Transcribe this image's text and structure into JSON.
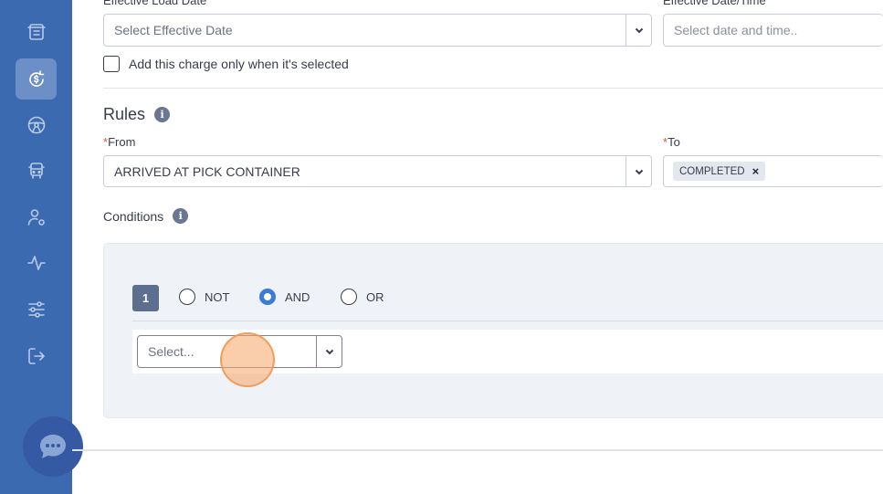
{
  "sidebar": {
    "items": [
      {
        "icon": "receipt-icon",
        "active": false
      },
      {
        "icon": "dollar-cycle-icon",
        "active": true
      },
      {
        "icon": "steering-wheel-icon",
        "active": false
      },
      {
        "icon": "truck-icon",
        "active": false
      },
      {
        "icon": "user-settings-icon",
        "active": false
      },
      {
        "icon": "activity-icon",
        "active": false
      },
      {
        "icon": "sliders-icon",
        "active": false
      },
      {
        "icon": "logout-icon",
        "active": false
      }
    ],
    "chat_icon": "chat-icon"
  },
  "form": {
    "effective_load_date_label": "Effective Load Date",
    "effective_load_date_placeholder": "Select Effective Date",
    "effective_datetime_label": "Effective Date/Time",
    "effective_datetime_placeholder": "Select date and time..",
    "checkbox_label": "Add this charge only when it's selected",
    "checkbox_checked": false
  },
  "rules": {
    "title": "Rules",
    "from_required": "*",
    "from_label": "From",
    "from_value": "ARRIVED AT PICK CONTAINER",
    "to_required": "*",
    "to_label": "To",
    "to_tags": [
      "COMPLETED"
    ],
    "tag_remove": "×"
  },
  "conditions": {
    "title": "Conditions",
    "group_number": "1",
    "operators": [
      {
        "label": "NOT",
        "checked": false
      },
      {
        "label": "AND",
        "checked": true
      },
      {
        "label": "OR",
        "checked": false
      }
    ],
    "select_placeholder": "Select..."
  },
  "colors": {
    "sidebar": "#3c6ab0",
    "accent": "#3b7ad9",
    "required": "#e5533c"
  }
}
